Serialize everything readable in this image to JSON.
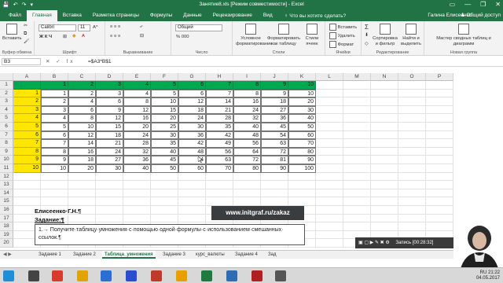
{
  "window": {
    "title": "Занятие8.xls  [Режим совместимости] - Excel",
    "qat": [
      "💾",
      "↶",
      "↷",
      "▾"
    ],
    "controls": [
      "▭",
      "—",
      "❐",
      "✕"
    ]
  },
  "tabs": [
    "Файл",
    "Главная",
    "Вставка",
    "Разметка страницы",
    "Формулы",
    "Данные",
    "Рецензирование",
    "Вид"
  ],
  "tell_me": "♀ Что вы хотите сделать?",
  "user": "Галина Елисеенко",
  "share": "♟ Общий доступ",
  "ribbon": {
    "paste": "Вставить",
    "clipboard": "Буфер обмена",
    "font_name": "Calibri",
    "font_size": "11",
    "font_group": "Шрифт",
    "font_buttons": "Ж  К  Ч",
    "align_group": "Выравнивание",
    "number_format": "Общий",
    "number_group": "Число",
    "number_buttons": "% 000",
    "cond_format": "Условное форматирование",
    "format_table": "Форматировать как таблицу",
    "cell_styles": "Стили ячеек",
    "styles_group": "Стили",
    "insert": "Вставить",
    "delete": "Удалить",
    "format": "Формат",
    "cells_group": "Ячейки",
    "sum": "Σ",
    "sort": "Сортировка и фильтр",
    "find": "Найти и выделить",
    "editing_group": "Редактирование",
    "pivot": "Мастер сводных таблиц и диаграмм",
    "pivot_group": "Новая группа"
  },
  "formula_bar": {
    "name_box": "B3",
    "fx": "✕ ✓ fx",
    "formula": "=$A3*B$1"
  },
  "columns": [
    "A",
    "B",
    "C",
    "D",
    "E",
    "F",
    "G",
    "H",
    "I",
    "J",
    "K",
    "L",
    "M",
    "N",
    "O",
    "P"
  ],
  "rows": [
    "1",
    "2",
    "3",
    "4",
    "5",
    "6",
    "7",
    "8",
    "9",
    "10",
    "11",
    "12",
    "13",
    "14",
    "15",
    "16",
    "17",
    "18",
    "19",
    "20",
    "21"
  ],
  "grid": {
    "header_row": [
      "1",
      "2",
      "3",
      "4",
      "5",
      "6",
      "7",
      "8",
      "9",
      "10"
    ],
    "first_col": [
      "1",
      "2",
      "3",
      "4",
      "5",
      "6",
      "7",
      "8",
      "9",
      "10"
    ],
    "body": [
      [
        "1",
        "2",
        "3",
        "4",
        "5",
        "6",
        "7",
        "8",
        "9",
        "10"
      ],
      [
        "2",
        "4",
        "6",
        "8",
        "10",
        "12",
        "14",
        "16",
        "18",
        "20"
      ],
      [
        "3",
        "6",
        "9",
        "12",
        "15",
        "18",
        "21",
        "24",
        "27",
        "30"
      ],
      [
        "4",
        "8",
        "12",
        "16",
        "20",
        "24",
        "28",
        "32",
        "36",
        "40"
      ],
      [
        "5",
        "10",
        "15",
        "20",
        "25",
        "30",
        "35",
        "40",
        "45",
        "50"
      ],
      [
        "6",
        "12",
        "18",
        "24",
        "30",
        "36",
        "42",
        "48",
        "54",
        "60"
      ],
      [
        "7",
        "14",
        "21",
        "28",
        "35",
        "42",
        "49",
        "56",
        "63",
        "70"
      ],
      [
        "8",
        "16",
        "24",
        "32",
        "40",
        "48",
        "56",
        "64",
        "72",
        "80"
      ],
      [
        "9",
        "18",
        "27",
        "36",
        "45",
        "54",
        "63",
        "72",
        "81",
        "90"
      ],
      [
        "10",
        "20",
        "30",
        "40",
        "50",
        "60",
        "70",
        "80",
        "90",
        "100"
      ]
    ]
  },
  "notes": {
    "author": "Елисеенко·Г.Н.¶",
    "task_title": "Задание:¶",
    "task_text": "1.→ Получите·таблицу·умножения·с·помощью·одной·формулы·с·использованием·смешанных· ссылок.¶"
  },
  "banner": "www.initgraf.ru/zakaz",
  "sheets": [
    "Задание 1",
    "Задание 2",
    "Таблица_умножения",
    "Задание 3",
    "курс_валюты",
    "Задание 4",
    "Зад"
  ],
  "active_sheet": 2,
  "recording": "Запись [00:28:32]",
  "tray": {
    "lang": "RU",
    "time": "21:22",
    "date": "04.05.2017"
  },
  "colors": {
    "excel_green": "#217346",
    "header_fill": "#00a84f",
    "first_col_fill": "#ffe600"
  }
}
